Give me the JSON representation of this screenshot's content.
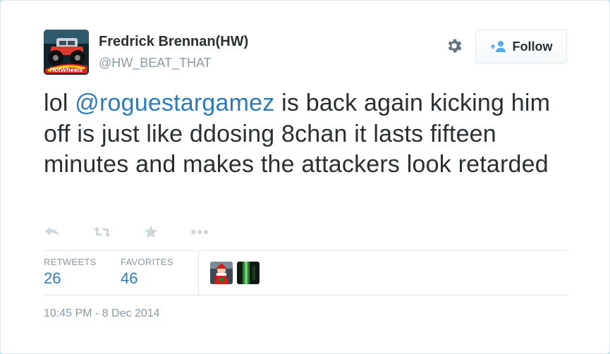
{
  "user": {
    "display_name": "Fredrick Brennan(HW)",
    "handle": "@HW_BEAT_THAT",
    "avatar_icon": "hot-wheels-monster-truck-avatar"
  },
  "follow_button": {
    "label": "Follow",
    "icon": "add-person-icon"
  },
  "tweet": {
    "prefix": "lol ",
    "mention": "@roguestargamez",
    "text": " is back again kicking him off is just like ddosing 8chan it lasts fifteen minutes and makes the attackers look retarded"
  },
  "actions": [
    "reply-icon",
    "retweet-icon",
    "favorite-star-icon",
    "more-dots-icon"
  ],
  "stats": {
    "retweets_label": "RETWEETS",
    "retweets_count": "26",
    "favorites_label": "FAVORITES",
    "favorites_count": "46"
  },
  "timestamp": "10:45 PM - 8 Dec 2014",
  "colors": {
    "link": "#2b7bb9",
    "text": "#292f33",
    "muted": "#8899a6",
    "border": "#e1e8ed",
    "icon": "#ccd6dd"
  }
}
